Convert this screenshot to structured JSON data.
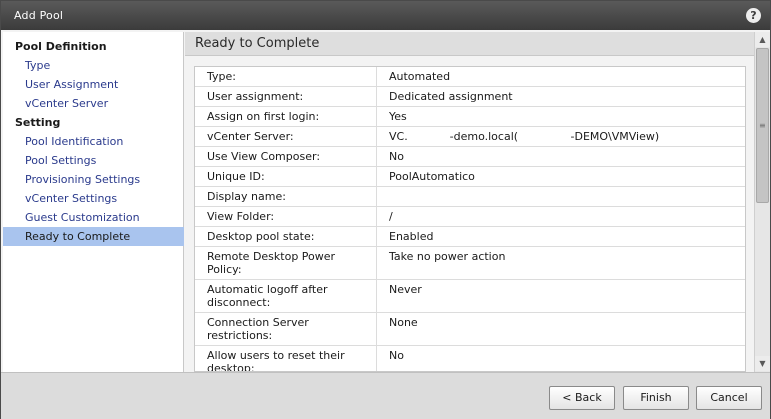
{
  "window": {
    "title": "Add Pool",
    "help_icon": "?"
  },
  "sidebar": {
    "sections": [
      {
        "header": "Pool Definition",
        "items": [
          "Type",
          "User Assignment",
          "vCenter Server"
        ]
      },
      {
        "header": "Setting",
        "items": [
          "Pool Identification",
          "Pool Settings",
          "Provisioning Settings",
          "vCenter Settings",
          "Guest Customization",
          "Ready to Complete"
        ]
      }
    ],
    "selected": "Ready to Complete"
  },
  "main": {
    "heading": "Ready to Complete"
  },
  "summary": [
    {
      "label": "Type:",
      "value": "Automated"
    },
    {
      "label": "User assignment:",
      "value": "Dedicated assignment"
    },
    {
      "label": "Assign on first login:",
      "value": "Yes"
    },
    {
      "label": "vCenter Server:",
      "value": "VC.            -demo.local(               -DEMO\\VMView)"
    },
    {
      "label": "Use View Composer:",
      "value": "No"
    },
    {
      "label": "Unique ID:",
      "value": "PoolAutomatico"
    },
    {
      "label": "Display name:",
      "value": ""
    },
    {
      "label": "View Folder:",
      "value": "/"
    },
    {
      "label": "Desktop pool state:",
      "value": "Enabled"
    },
    {
      "label": "Remote Desktop Power Policy:",
      "value": "Take no power action"
    },
    {
      "label": "Automatic logoff after disconnect:",
      "value": "Never"
    },
    {
      "label": "Connection Server restrictions:",
      "value": "None"
    },
    {
      "label": "Allow users to reset their desktop:",
      "value": "No"
    }
  ],
  "footer": {
    "back_label": "< Back",
    "finish_label": "Finish",
    "cancel_label": "Cancel"
  },
  "icons": {
    "help": "help-icon",
    "scroll_up": "arrow-up-icon",
    "scroll_down": "arrow-down-icon"
  },
  "colors": {
    "selected_bg": "#a9c4ee",
    "link": "#2a3a8c",
    "titlebar": "#3b3b3b"
  }
}
